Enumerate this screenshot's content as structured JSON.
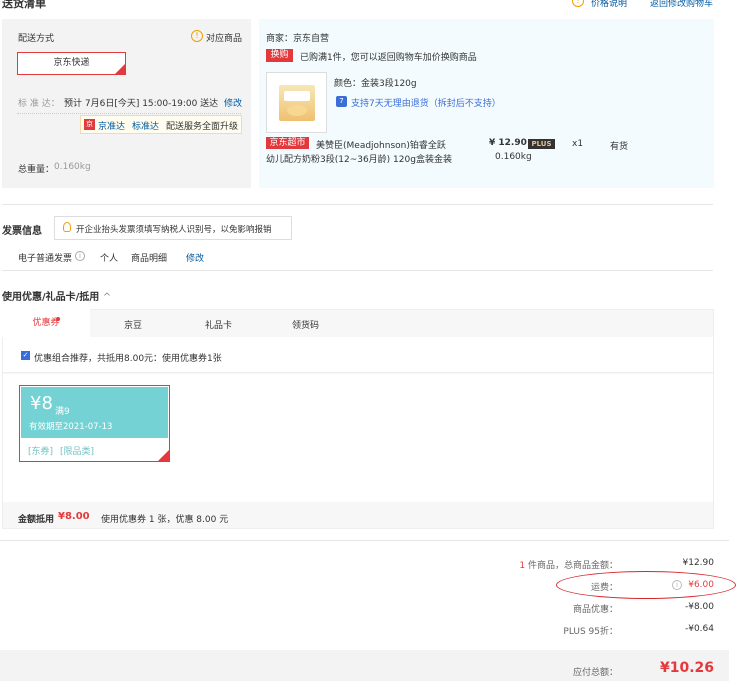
{
  "header": {
    "title": "送货清单",
    "price_info_label": "价格说明",
    "back_to_cart_label": "返回修改购物车"
  },
  "shipping": {
    "method_label": "配送方式",
    "matching_goods_label": "对应商品",
    "selected_method": "京东快递",
    "std_label": "标 准 达：",
    "std_time": "预计 7月6日[今天] 15:00-19:00 送达",
    "modify_label": "修改",
    "upgrade": {
      "badge": "京",
      "brand": "京准达",
      "standard": "标准达",
      "text": "配送服务全面升级"
    },
    "weight_label": "总重量：",
    "weight_value": "0.160kg"
  },
  "product": {
    "merchant": "商家：京东自营",
    "swap_tag": "换购",
    "swap_text": "已购满1件，您可以返回购物车加价换购商品",
    "color": "颜色：金装3段120g",
    "return_badge": "7",
    "return_text": "支持7天无理由退货（拆封后不支持）",
    "store_tag": "京东超市",
    "name_line1": "美赞臣(Meadjohnson)铂睿全跃",
    "name_line2": "幼儿配方奶粉3段(12~36月龄) 120g盒装金装",
    "price": "¥ 12.90",
    "plus_tag": "PLUS",
    "quantity": "x1",
    "stock": "有货",
    "weight": "0.160kg"
  },
  "invoice": {
    "title": "发票信息",
    "tip": "开企业抬头发票须填写纳税人识别号，以免影响报销",
    "type": "电子普通发票",
    "person": "个人",
    "detail": "商品明细",
    "modify_label": "修改"
  },
  "discount": {
    "title": "使用优惠/礼品卡/抵用",
    "chevron": "^",
    "tabs": [
      "优惠券",
      "京豆",
      "礼品卡",
      "领货码"
    ],
    "combo_text": "优惠组合推荐，共抵用8.00元：使用优惠券1张",
    "coupon": {
      "amount": "¥8",
      "threshold": "满9",
      "valid": "有效期至2021-07-13",
      "tag1": "[东券]",
      "tag2": "[限品类]"
    },
    "summary_label": "金额抵用",
    "summary_amount": "¥8.00",
    "summary_text": "使用优惠券 1 张，优惠 8.00 元"
  },
  "totals": {
    "count": "1",
    "count_text": "件商品，总商品金额：",
    "goods_total": "¥12.90",
    "shipping_label": "运费：",
    "shipping_value": "¥6.00",
    "discount_label": "商品优惠：",
    "discount_value": "-¥8.00",
    "plus_label": "PLUS 95折：",
    "plus_value": "-¥0.64",
    "payable_label": "应付总额：",
    "payable_value": "¥10.26"
  },
  "colors": {
    "accent": "#e4393c",
    "link": "#005aa0",
    "coupon": "#74d2d4",
    "panel": "#f3f3f3",
    "product_bg": "#f3fbfe"
  }
}
